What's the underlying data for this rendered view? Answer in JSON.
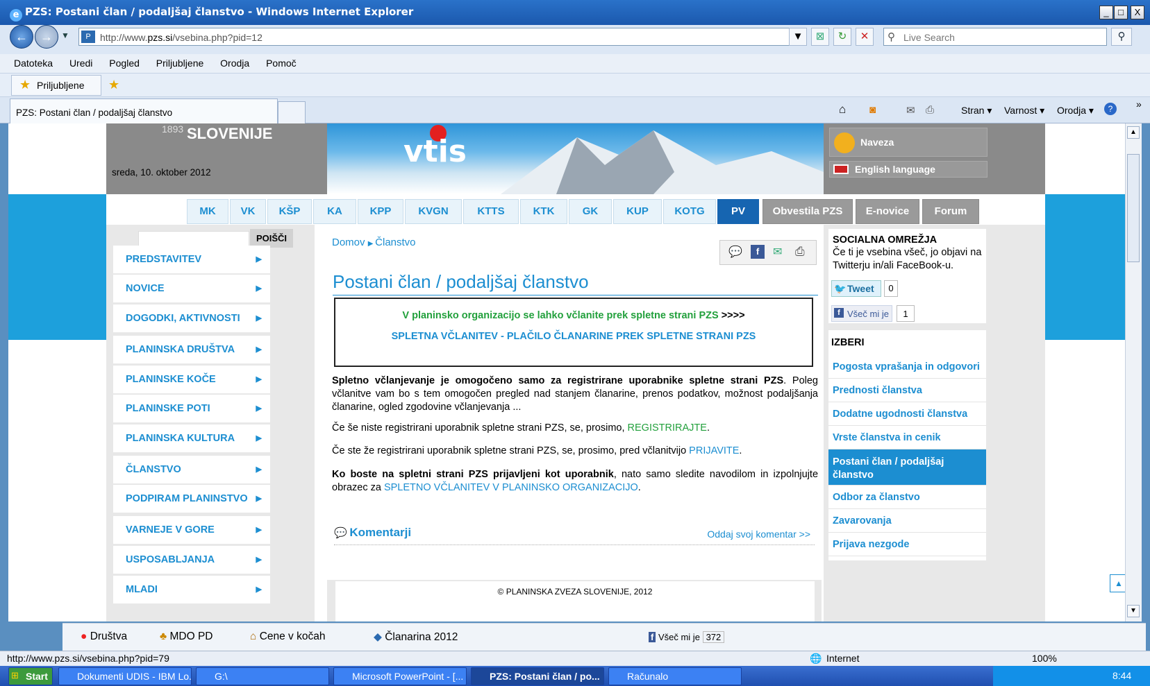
{
  "window": {
    "title": "PZS: Postani član / podaljšaj članstvo - Windows Internet Explorer",
    "min": "_",
    "max": "□",
    "close": "X"
  },
  "address": {
    "url_prefix": "http://www.",
    "url_domain": "pzs.si",
    "url_path": "/vsebina.php?pid=12",
    "search_placeholder": "Live Search"
  },
  "menu": [
    "Datoteka",
    "Uredi",
    "Pogled",
    "Priljubljene",
    "Orodja",
    "Pomoč"
  ],
  "favorites": {
    "label": "Priljubljene"
  },
  "tab": {
    "title": "PZS: Postani član / podaljšaj članstvo"
  },
  "commandbar": {
    "stran": "Stran ▾",
    "varnost": "Varnost ▾",
    "orodja": "Orodja ▾"
  },
  "header": {
    "logo_year": "1893",
    "logo_text": "SLOVENIJE",
    "date": "sreda, 10. oktober 2012",
    "banner_text": "vtis",
    "naveza": "Naveza",
    "english": "English language"
  },
  "nav": {
    "tabs": [
      "MK",
      "VK",
      "KŠP",
      "KA",
      "KPP",
      "KVGN",
      "KTTS",
      "KTK",
      "GK",
      "KUP",
      "KOTG",
      "PV"
    ],
    "gray": [
      "Obvestila PZS",
      "E-novice",
      "Forum"
    ]
  },
  "search": {
    "button": "POIŠČI"
  },
  "leftmenu": [
    "PREDSTAVITEV",
    "NOVICE",
    "DOGODKI, AKTIVNOSTI",
    "PLANINSKA DRUŠTVA",
    "PLANINSKE KOČE",
    "PLANINSKE POTI",
    "PLANINSKA KULTURA",
    "ČLANSTVO",
    "PODPIRAM PLANINSTVO",
    "VARNEJE V GORE",
    "USPOSABLJANJA",
    "MLADI"
  ],
  "breadcrumb": {
    "home": "Domov",
    "current": "Članstvo"
  },
  "page": {
    "title": "Postani član / podaljšaj članstvo",
    "notice_line1": "V planinsko organizacijo se lahko včlanite prek spletne strani PZS",
    "notice_arrows": " >>>>",
    "notice_line2": "SPLETNA VČLANITEV - PLAČILO ČLANARINE PREK SPLETNE STRANI PZS",
    "p1_bold": "Spletno včlanjevanje je omogočeno samo za registrirane uporabnike spletne strani PZS",
    "p1_rest": ". Poleg včlanitve vam bo s tem omogočen pregled nad stanjem članarine, prenos podatkov, možnost podaljšanja članarine, ogled zgodovine včlanjevanja ...",
    "p2_text": "Če še niste registrirani uporabnik spletne strani PZS, se, prosimo, ",
    "p2_link": "REGISTRIRAJTE",
    "p3_text": "Če ste že registrirani uporabnik spletne strani PZS, se, prosimo, pred včlanitvijo ",
    "p3_link": "PRIJAVITE",
    "p4_bold": "Ko boste na spletni strani PZS prijavljeni kot uporabnik",
    "p4_text": ", nato samo sledite navodilom in izpolnjujte obrazec za ",
    "p4_link": "SPLETNO VČLANITEV V PLANINSKO ORGANIZACIJO",
    "comments": "Komentarji",
    "comment_link": "Oddaj svoj komentar >>",
    "footer": "© PLANINSKA ZVEZA SLOVENIJE, 2012"
  },
  "social": {
    "title": "SOCIALNA OMREŽJA",
    "text": "Če ti je vsebina všeč, jo objavi na Twitterju in/ali FaceBook-u.",
    "tweet": "Tweet",
    "tweet_count": "0",
    "like": "Všeč mi je",
    "like_count": "1"
  },
  "izberi": {
    "title": "IZBERI",
    "items": [
      "Pogosta vprašanja in odgovori",
      "Prednosti članstva",
      "Dodatne ugodnosti članstva",
      "Vrste članstva in cenik",
      "Postani član / podaljšaj članstvo",
      "Odbor za članstvo",
      "Zavarovanja",
      "Prijava nezgode"
    ]
  },
  "linksbar": {
    "drustva": "Društva",
    "mdo": "MDO PD",
    "cene": "Cene v kočah",
    "clanarina": "Članarina 2012",
    "like": "Všeč mi je",
    "like_count": "372"
  },
  "status": {
    "url": "http://www.pzs.si/vsebina.php?pid=79",
    "zone": "Internet",
    "zoom": "100%"
  },
  "taskbar": {
    "start": "Start",
    "items": [
      "Dokumenti UDIS - IBM Lo...",
      "G:\\",
      "Microsoft PowerPoint - [...",
      "PZS: Postani član / po...",
      "Računalo"
    ],
    "time": "8:44"
  }
}
